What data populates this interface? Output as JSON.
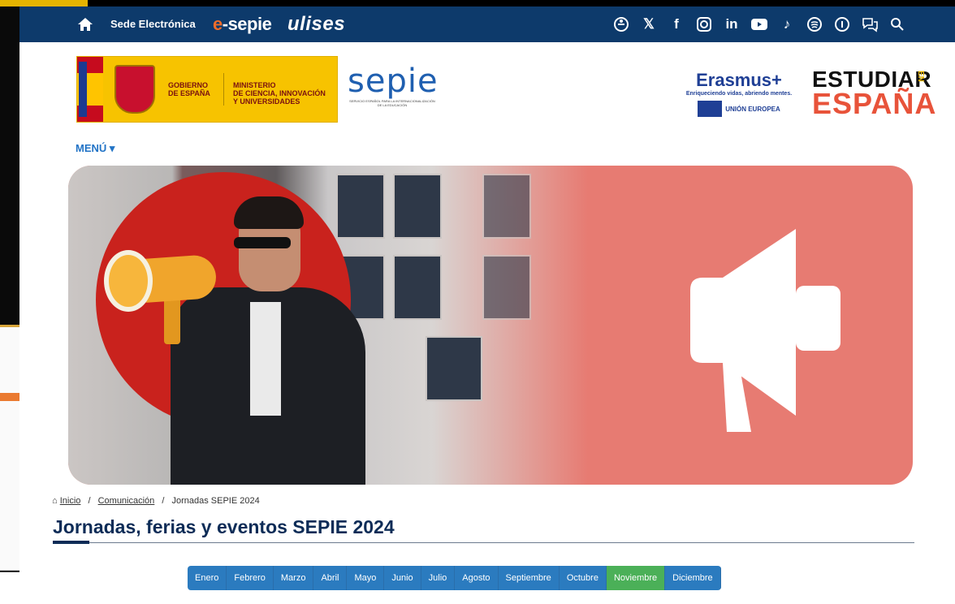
{
  "topbar": {
    "sede_label": "Sede Electrónica",
    "esepie_e": "e",
    "esepie_rest": "-sepie",
    "ulises": "ulises",
    "social_icons": [
      "accessibility-icon",
      "x-icon",
      "facebook-icon",
      "instagram-icon",
      "linkedin-icon",
      "youtube-icon",
      "tiktok-icon",
      "spotify-icon",
      "info-icon",
      "chat-icon",
      "search-icon"
    ]
  },
  "logos": {
    "gov_line1": "GOBIERNO",
    "gov_line2": "DE ESPAÑA",
    "ministry_line1": "MINISTERIO",
    "ministry_line2": "DE CIENCIA, INNOVACIÓN",
    "ministry_line3": "Y UNIVERSIDADES",
    "sepie_word": "sepie",
    "sepie_sub": "SERVICIO ESPAÑOL PARA LA INTERNACIONALIZACIÓN DE LA EDUCACIÓN",
    "erasmus_title": "Erasmus+",
    "erasmus_slogan": "Enriqueciendo vidas, abriendo mentes.",
    "eu_label": "UNIÓN EUROPEA",
    "estudiar_l1": "ESTUDIAR",
    "estudiar_en": "EN",
    "estudiar_l2": "ESPAÑA"
  },
  "nav": {
    "menu_label": "MENÚ ▾"
  },
  "breadcrumb": {
    "home": "Inicio",
    "section": "Comunicación",
    "current": "Jornadas SEPIE 2024",
    "sep": "/"
  },
  "page": {
    "title": "Jornadas, ferias y eventos SEPIE 2024"
  },
  "months": {
    "items": [
      "Enero",
      "Febrero",
      "Marzo",
      "Abril",
      "Mayo",
      "Junio",
      "Julio",
      "Agosto",
      "Septiembre",
      "Octubre",
      "Noviembre",
      "Diciembre"
    ],
    "active": "Noviembre"
  },
  "colors": {
    "topbar": "#0d3a6b",
    "link": "#2173c6",
    "month_button": "#2b7bbf",
    "month_active": "#4bb058",
    "hero_accent": "#e77b72",
    "title": "#0d2c57"
  }
}
